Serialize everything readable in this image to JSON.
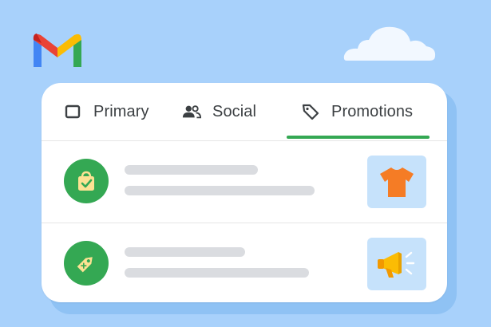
{
  "brand": {
    "logo_icon": "gmail-logo-icon"
  },
  "tabs": [
    {
      "label": "Primary",
      "icon": "inbox-icon",
      "selected": false
    },
    {
      "label": "Social",
      "icon": "people-icon",
      "selected": false
    },
    {
      "label": "Promotions",
      "icon": "tag-icon",
      "selected": true
    }
  ],
  "messages": [
    {
      "avatar_icon": "shopping-bag-check-icon",
      "thumbnail_icon": "tshirt-icon"
    },
    {
      "avatar_icon": "price-tag-icon",
      "thumbnail_icon": "megaphone-icon"
    }
  ],
  "colors": {
    "background": "#a8d1fb",
    "accent_green": "#34a853",
    "placeholder_line": "#dadce0",
    "thumbnail_bg": "#c6e2fb"
  }
}
